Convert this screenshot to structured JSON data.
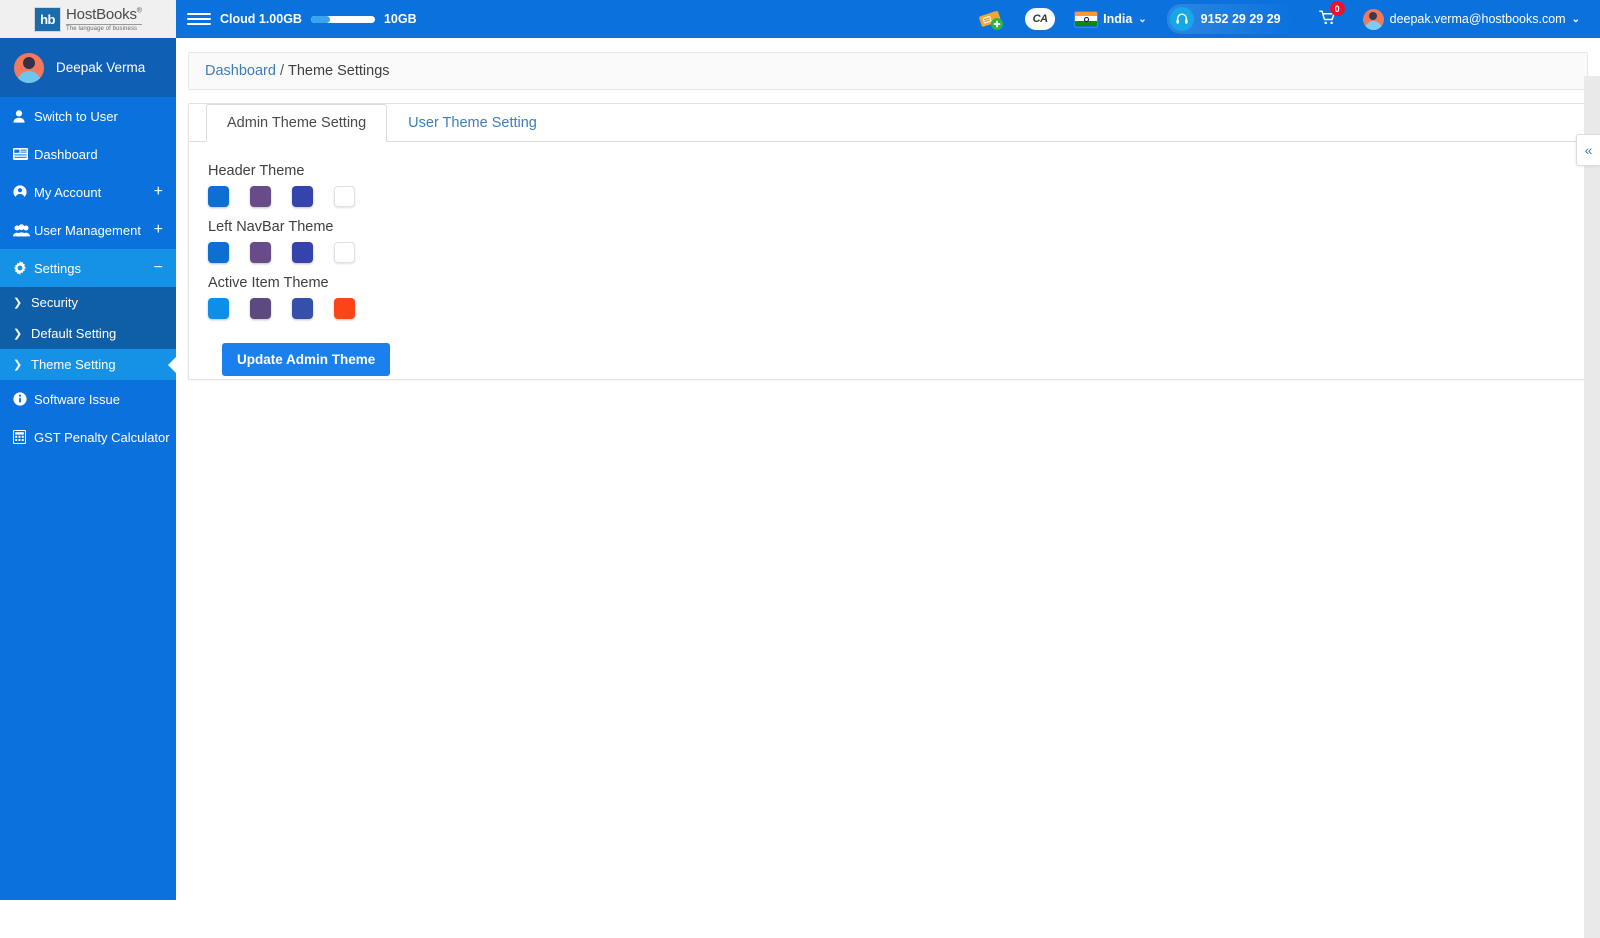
{
  "brand": {
    "logo_mark": "hb",
    "name": "HostBooks",
    "registered": "®",
    "tagline": "The language of business"
  },
  "header": {
    "menu_icon": "hamburger-icon",
    "storage_label": "Cloud 1.00GB",
    "storage_max": "10GB",
    "storage_percent": 10,
    "storage_fill_color": "#38a6ef",
    "ticket_icon": "add-ticket-icon",
    "ca_badge": "CA",
    "country": "India",
    "country_flag": "india-flag-icon",
    "support_icon": "headset-icon",
    "support_phone": "9152 29 29 29",
    "cart_icon": "cart-icon",
    "cart_count": "0",
    "cart_badge_color": "#e8142d",
    "user_email": "deepak.verma@hostbooks.com",
    "caret": "⌄",
    "bar_color": "#0b72dd"
  },
  "sidebar": {
    "profile": {
      "name": "Deepak Verma",
      "avatar": "user-avatar"
    },
    "items": [
      {
        "label": "Switch to User",
        "icon": "user-icon",
        "expander": "",
        "active": false
      },
      {
        "label": "Dashboard",
        "icon": "dashboard-icon",
        "expander": "",
        "active": false
      },
      {
        "label": "My Account",
        "icon": "account-circle-icon",
        "expander": "+",
        "active": false
      },
      {
        "label": "User Management",
        "icon": "users-group-icon",
        "expander": "+",
        "active": false
      },
      {
        "label": "Settings",
        "icon": "gear-icon",
        "expander": "−",
        "active": true
      }
    ],
    "submenu": [
      {
        "label": "Security",
        "icon": "chevron-right-icon",
        "active": false
      },
      {
        "label": "Default Setting",
        "icon": "chevron-right-icon",
        "active": false
      },
      {
        "label": "Theme Setting",
        "icon": "chevron-right-icon",
        "active": true
      }
    ],
    "items_after": [
      {
        "label": "Software Issue",
        "icon": "info-circle-icon",
        "expander": "",
        "active": false
      },
      {
        "label": "GST Penalty Calculator",
        "icon": "calculator-icon",
        "expander": "",
        "active": false
      }
    ],
    "bg_color": "#0b72dd",
    "active_color": "#1592e6",
    "submenu_bg_color": "#0e5ea8"
  },
  "breadcrumb": {
    "root": "Dashboard",
    "separator": "/",
    "current": "Theme Settings"
  },
  "main": {
    "tabs": [
      {
        "label": "Admin Theme Setting",
        "active": true
      },
      {
        "label": "User Theme Setting",
        "active": false
      }
    ],
    "groups": [
      {
        "label": "Header Theme",
        "swatches": [
          {
            "color": "#0d6fd1",
            "light": false
          },
          {
            "color": "#6a4b8a",
            "light": false
          },
          {
            "color": "#3543ad",
            "light": false
          },
          {
            "color": "#ffffff",
            "light": true
          }
        ]
      },
      {
        "label": "Left NavBar Theme",
        "swatches": [
          {
            "color": "#0d6fd1",
            "light": false
          },
          {
            "color": "#6a4b8a",
            "light": false
          },
          {
            "color": "#3543ad",
            "light": false
          },
          {
            "color": "#ffffff",
            "light": true
          }
        ]
      },
      {
        "label": "Active Item Theme",
        "swatches": [
          {
            "color": "#0d8fe8",
            "light": false
          },
          {
            "color": "#5c4a7e",
            "light": false
          },
          {
            "color": "#3450a8",
            "light": false
          },
          {
            "color": "#fa4616",
            "light": false
          }
        ]
      }
    ],
    "update_button": "Update Admin Theme",
    "update_button_color": "#1a80f0",
    "collapse_icon": "«"
  }
}
